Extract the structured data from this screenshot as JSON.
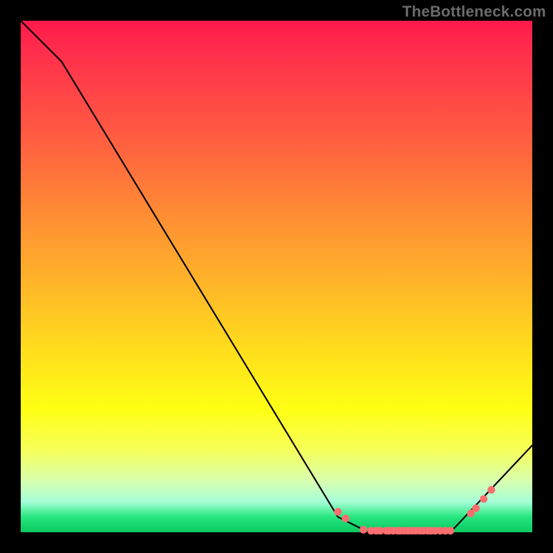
{
  "watermark": "TheBottleneck.com",
  "colors": {
    "background": "#000000",
    "gradient_top": "#ff1a4b",
    "gradient_bottom": "#0bc861",
    "curve": "#000000",
    "marker_fill": "#fa6e70",
    "marker_stroke": "#fa6e70"
  },
  "chart_data": {
    "type": "line",
    "title": "",
    "xlabel": "",
    "ylabel": "",
    "xlim": [
      0,
      100
    ],
    "ylim": [
      0,
      100
    ],
    "grid": false,
    "series": [
      {
        "name": "bottleneck-curve",
        "x": [
          0,
          8,
          62,
          68,
          84,
          100
        ],
        "y": [
          100,
          92,
          3,
          0,
          0,
          17
        ]
      }
    ],
    "markers": [
      {
        "x": 62.0,
        "y": 4.0
      },
      {
        "x": 63.5,
        "y": 2.7
      },
      {
        "x": 67.0,
        "y": 0.5
      },
      {
        "x": 68.5,
        "y": 0.3
      },
      {
        "x": 69.5,
        "y": 0.3
      },
      {
        "x": 70.3,
        "y": 0.3
      },
      {
        "x": 71.5,
        "y": 0.3
      },
      {
        "x": 72.0,
        "y": 0.3
      },
      {
        "x": 72.8,
        "y": 0.3
      },
      {
        "x": 73.7,
        "y": 0.3
      },
      {
        "x": 74.2,
        "y": 0.3
      },
      {
        "x": 75.0,
        "y": 0.3
      },
      {
        "x": 75.7,
        "y": 0.3
      },
      {
        "x": 76.4,
        "y": 0.3
      },
      {
        "x": 77.2,
        "y": 0.3
      },
      {
        "x": 78.0,
        "y": 0.3
      },
      {
        "x": 78.7,
        "y": 0.3
      },
      {
        "x": 79.5,
        "y": 0.3
      },
      {
        "x": 80.2,
        "y": 0.3
      },
      {
        "x": 81.0,
        "y": 0.3
      },
      {
        "x": 82.0,
        "y": 0.3
      },
      {
        "x": 83.0,
        "y": 0.3
      },
      {
        "x": 84.0,
        "y": 0.3
      },
      {
        "x": 88.0,
        "y": 3.7
      },
      {
        "x": 89.0,
        "y": 4.7
      },
      {
        "x": 90.5,
        "y": 6.5
      },
      {
        "x": 92.0,
        "y": 8.3
      }
    ]
  }
}
